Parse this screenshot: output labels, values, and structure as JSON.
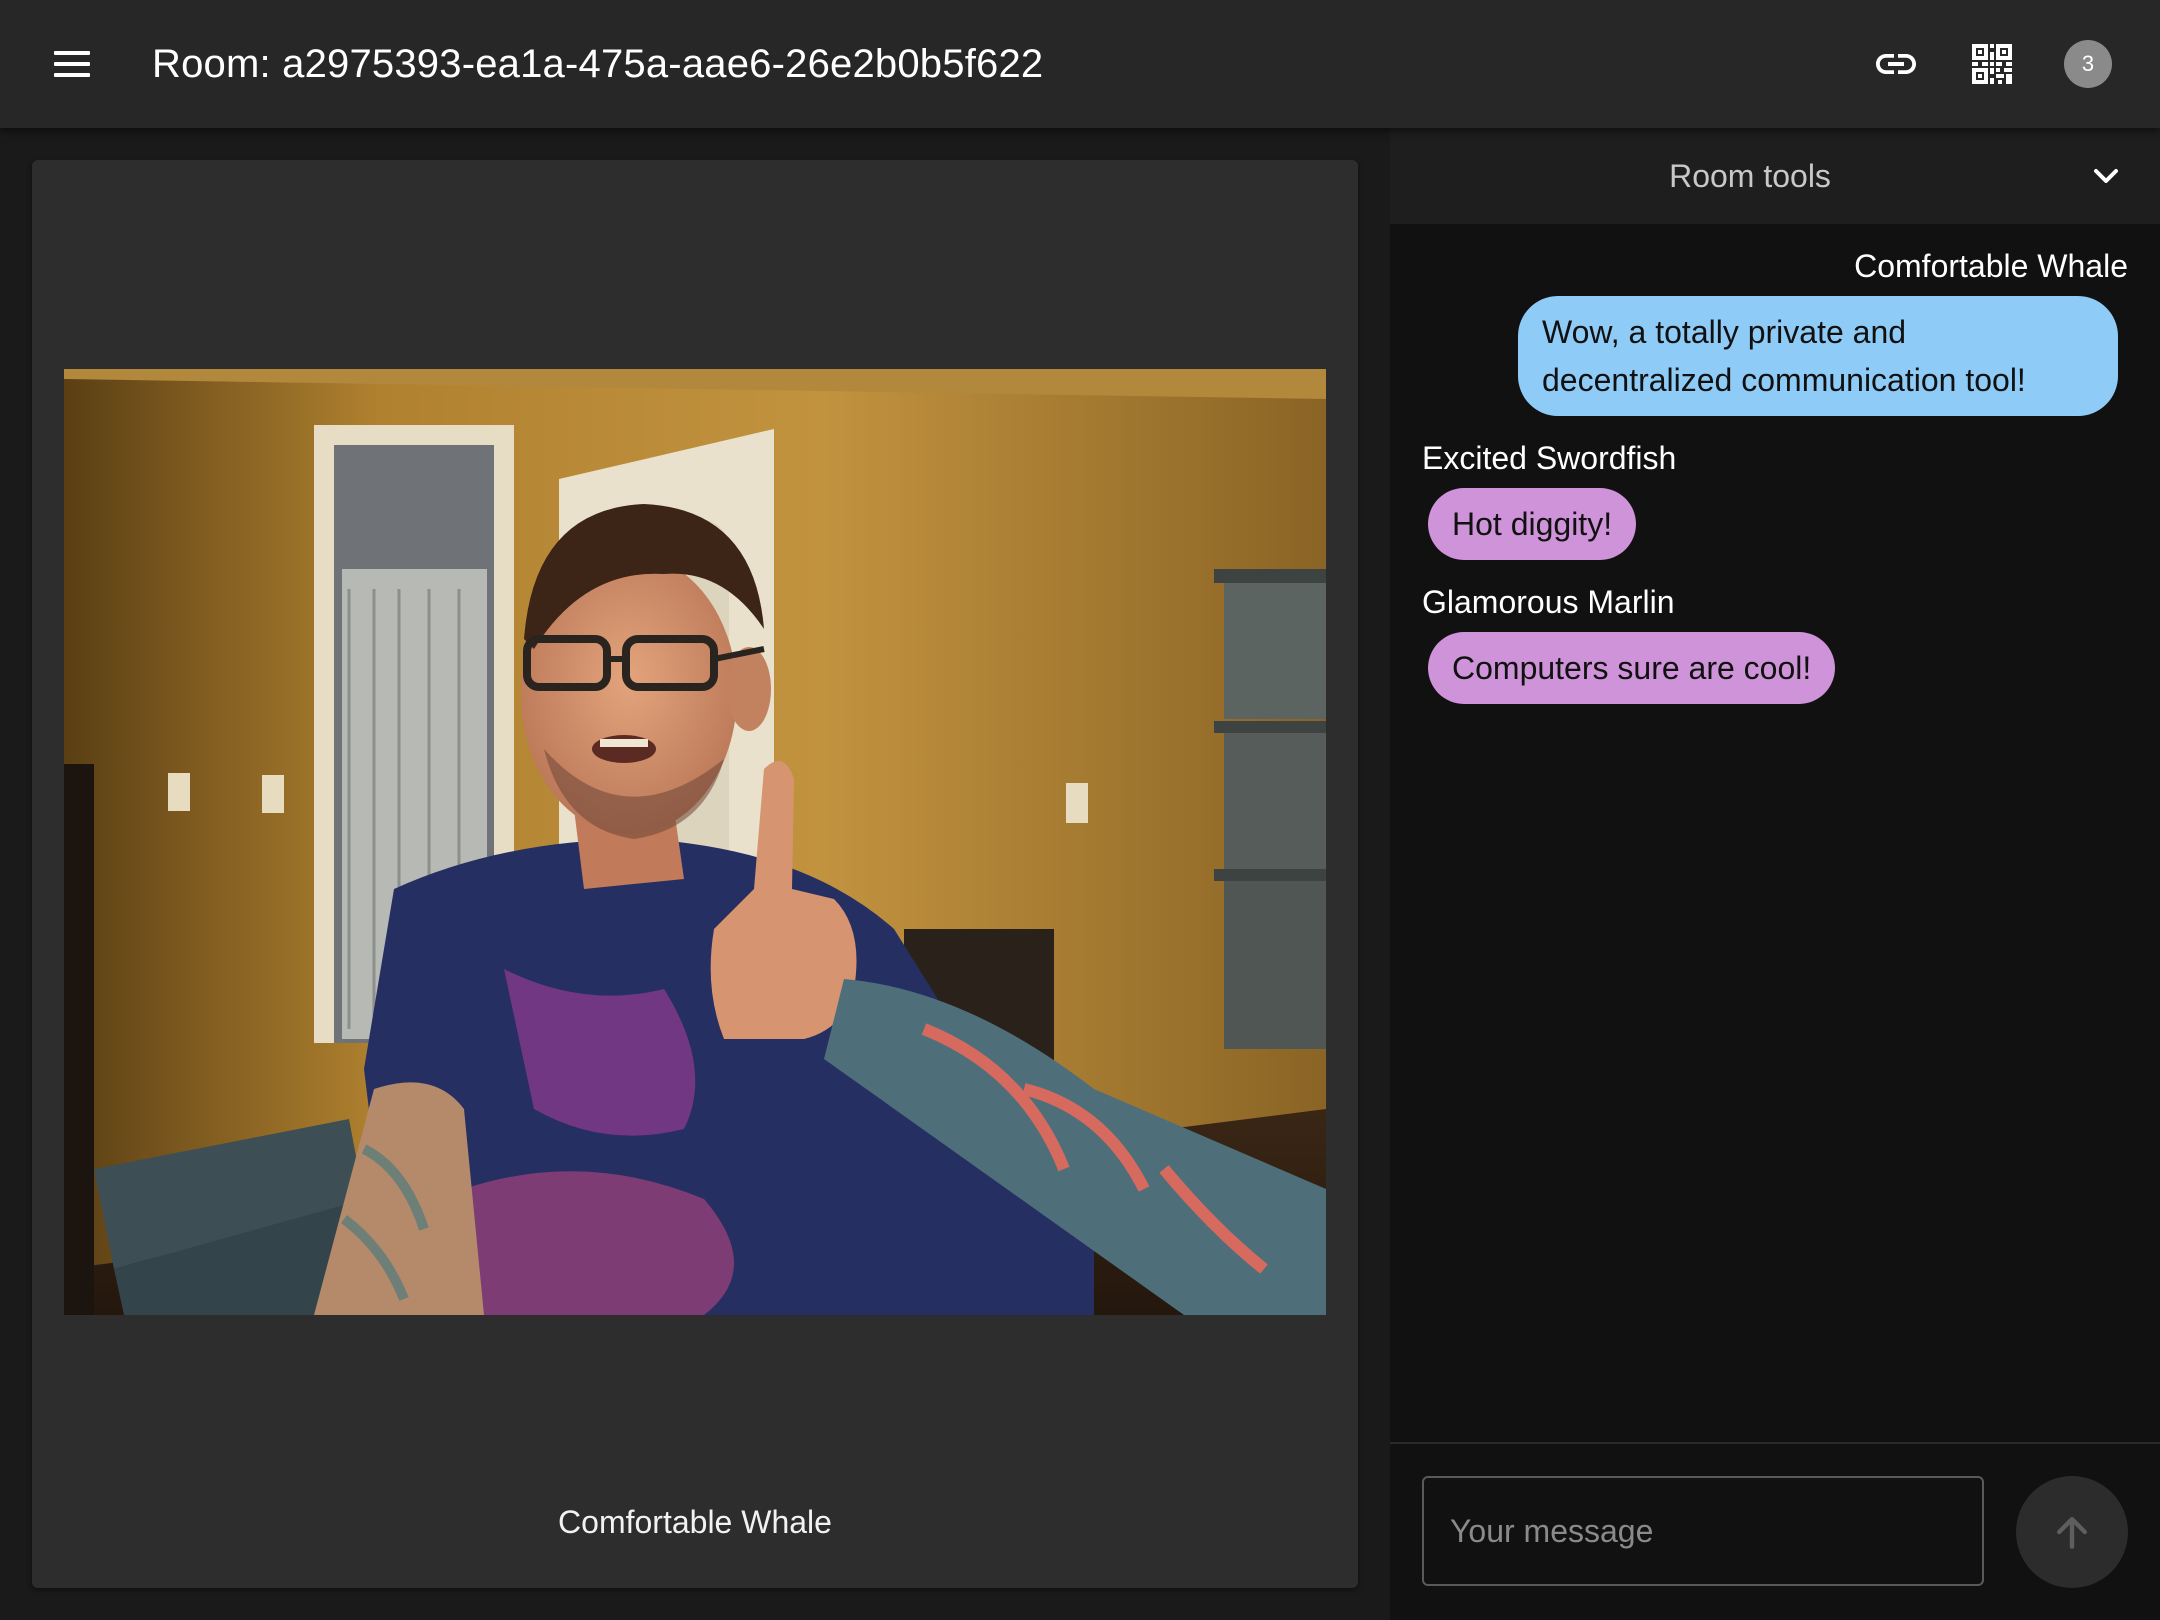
{
  "header": {
    "room_title": "Room: a2975393-ea1a-475a-aae6-26e2b0b5f622",
    "peer_count": "3",
    "icons": {
      "menu": "menu-icon",
      "link": "link-icon",
      "qr": "qr-code-icon"
    }
  },
  "video": {
    "caption": "Comfortable Whale"
  },
  "room_tools": {
    "label": "Room tools",
    "icon": "chevron-down-icon"
  },
  "messages": [
    {
      "author": "Comfortable Whale",
      "line1": "Wow, a totally private and",
      "line2": "decentralized communication tool!",
      "own": true
    },
    {
      "author": "Excited Swordfish",
      "text": "Hot diggity!",
      "own": false
    },
    {
      "author": "Glamorous Marlin",
      "text": "Computers sure are cool!",
      "own": false
    }
  ],
  "composer": {
    "placeholder": "Your message",
    "send_icon": "arrow-up-icon"
  },
  "colors": {
    "own_bubble": "#8ecbf7",
    "other_bubble": "#ce93d8",
    "app_bar": "#272727",
    "panel": "#111111"
  }
}
